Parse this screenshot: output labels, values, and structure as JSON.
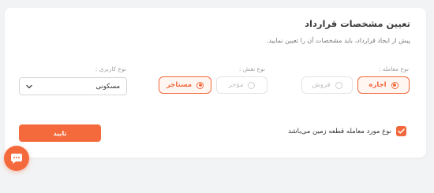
{
  "header": {
    "title": "تعیین مشخصات قرارداد",
    "subtitle": "پیش از ایجاد قرارداد، باید مشخصات آن را تعیین نمایید."
  },
  "transaction_type": {
    "label": "نوع معامله :",
    "options": [
      {
        "label": "اجاره",
        "selected": true
      },
      {
        "label": "فروش",
        "selected": false
      }
    ]
  },
  "role_type": {
    "label": "نوع نقش :",
    "options": [
      {
        "label": "مؤجر",
        "selected": false
      },
      {
        "label": "مستاجر",
        "selected": true
      }
    ]
  },
  "usage_type": {
    "label": "نوع کاربری :",
    "value": "مسکونی"
  },
  "land_checkbox": {
    "label": "نوع مورد معامله قطعه زمین می‌باشد",
    "checked": true
  },
  "confirm_button": {
    "label": "تایید"
  },
  "colors": {
    "accent": "#f2683c",
    "accent_bg": "#fff6f2",
    "card_bg": "#ffffff",
    "page_bg": "#f2f3f5"
  },
  "icons": {
    "checkbox": "check-icon",
    "select": "chevron-down-icon",
    "chat": "chat-icon"
  }
}
